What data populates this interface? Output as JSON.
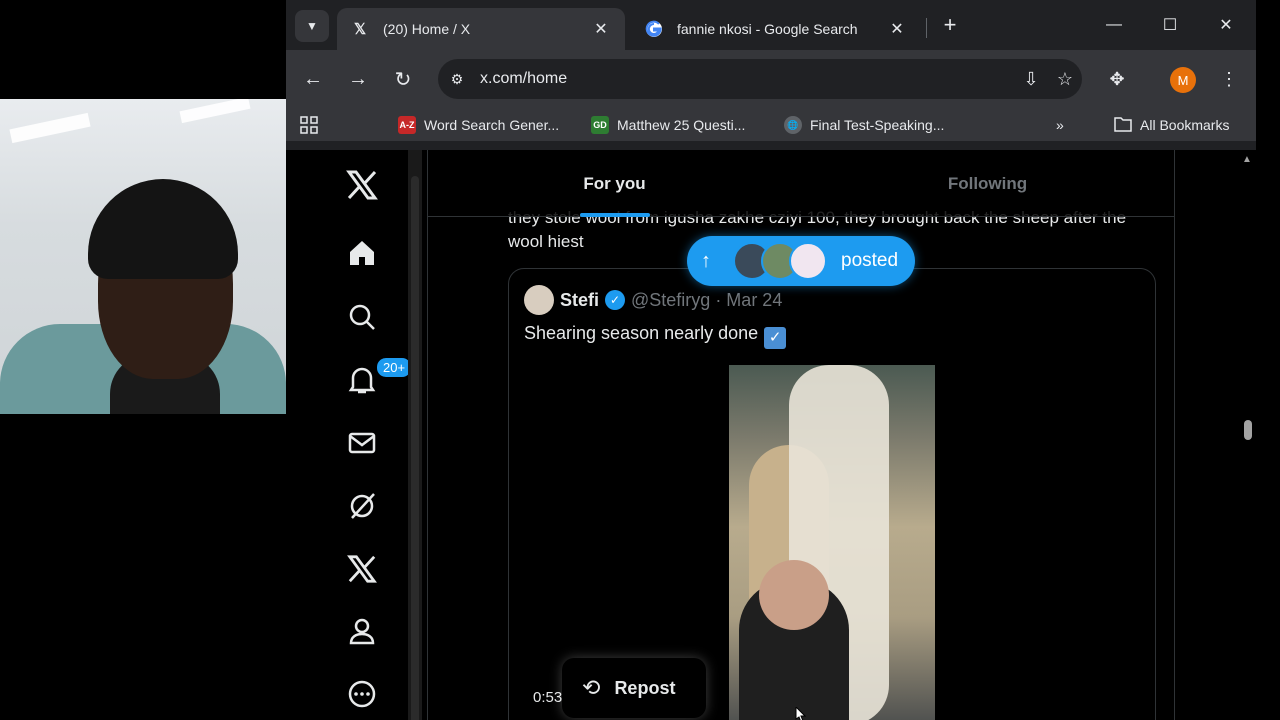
{
  "browser": {
    "tabs": [
      {
        "title": "(20) Home / X",
        "favicon": "x-logo-icon",
        "active": true
      },
      {
        "title": "fannie nkosi - Google Search",
        "favicon": "google-icon",
        "active": false
      }
    ],
    "tab_close_glyph": "✕",
    "new_tab_glyph": "+",
    "url": "x.com/home",
    "profile_initial": "M",
    "bookmarks": [
      {
        "label": "Word Search Gener...",
        "icon": "az-icon",
        "icon_text": "A-Z"
      },
      {
        "label": "Matthew 25 Questi...",
        "icon": "gd-icon",
        "icon_text": "GD"
      },
      {
        "label": "Final Test-Speaking...",
        "icon": "globe-icon",
        "icon_text": "🌐"
      }
    ],
    "all_bookmarks": "All Bookmarks",
    "accent_color": "#e8710a"
  },
  "x": {
    "notifications_badge": "20+",
    "tabs": {
      "for_you": "For you",
      "following": "Following"
    },
    "post_text": "they stole wool from igusha zakhe cziyi 100, they brought back the sheep after the wool hiest",
    "new_posts_label": "posted",
    "quoted": {
      "name": "Stefi",
      "handle": "@Stefiryg",
      "date": "· Mar 24",
      "text": "Shearing season nearly done",
      "check": "✓",
      "video_time": "0:53"
    },
    "repost_label": "Repost",
    "accent_color": "#1d9bf0"
  }
}
